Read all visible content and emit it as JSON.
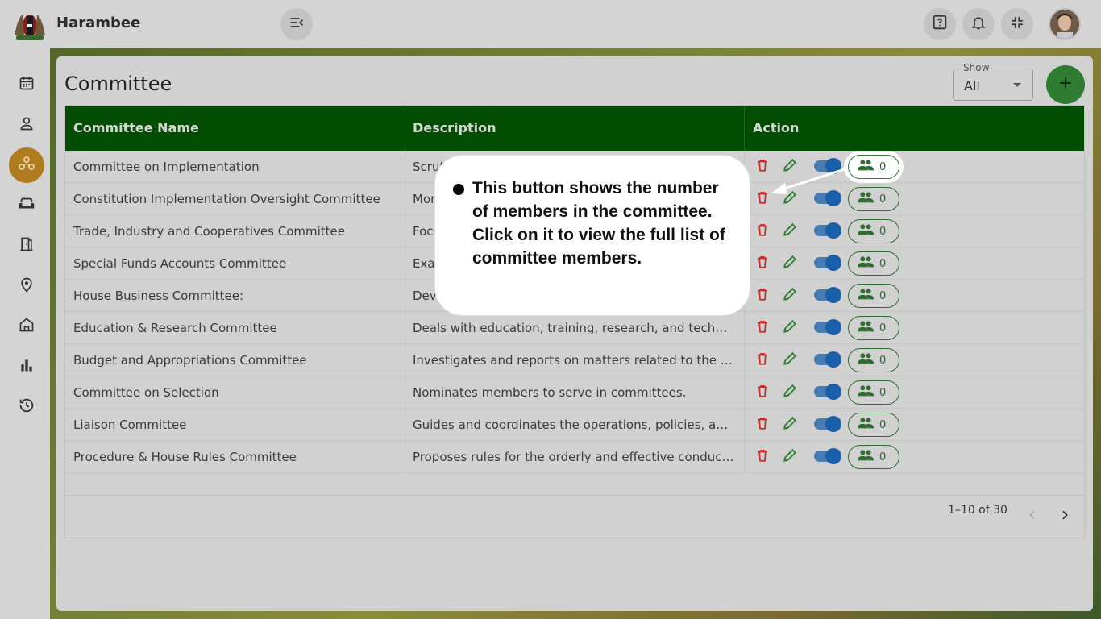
{
  "app": {
    "name": "Harambee"
  },
  "header": {
    "icons": [
      "menu-collapse-icon",
      "help-icon",
      "bell-icon",
      "fullscreen-exit-icon",
      "avatar"
    ]
  },
  "sidebar": {
    "items": [
      {
        "icon": "calendar-icon"
      },
      {
        "icon": "person-icon"
      },
      {
        "icon": "committee-icon",
        "active": true
      },
      {
        "icon": "sofa-icon"
      },
      {
        "icon": "door-icon"
      },
      {
        "icon": "location-pin-icon"
      },
      {
        "icon": "building-icon"
      },
      {
        "icon": "bar-chart-icon"
      },
      {
        "icon": "history-icon"
      }
    ]
  },
  "page": {
    "title": "Committee",
    "show_label": "Show",
    "show_value": "All"
  },
  "table": {
    "headers": {
      "name": "Committee Name",
      "description": "Description",
      "action": "Action"
    },
    "rows": [
      {
        "name": "Committee on Implementation",
        "description": "Scrutinizes the resolutions of the House",
        "members": "0"
      },
      {
        "name": "Constitution Implementation Oversight Committee",
        "description": "Monitors the implementation of the Constitution",
        "members": "0"
      },
      {
        "name": "Trade, Industry and Cooperatives Committee",
        "description": "Focuses on trade, industry and cooperatives",
        "members": "0"
      },
      {
        "name": "Special Funds Accounts Committee",
        "description": "Examines the accounts of special funds",
        "members": "0"
      },
      {
        "name": "House Business Committee:",
        "description": "Develops the programme of the House",
        "members": "0"
      },
      {
        "name": "Education & Research Committee",
        "description": "Deals with education, training, research, and technolo...",
        "members": "0"
      },
      {
        "name": "Budget and Appropriations Committee",
        "description": "Investigates and reports on matters related to the nati...",
        "members": "0"
      },
      {
        "name": "Committee on Selection",
        "description": "Nominates members to serve in committees.",
        "members": "0"
      },
      {
        "name": "Liaison Committee",
        "description": "Guides and coordinates the operations, policies, and ...",
        "members": "0"
      },
      {
        "name": "Procedure & House Rules Committee",
        "description": "Proposes rules for the orderly and effective conduct of ...",
        "members": "0"
      }
    ],
    "pagination": "1–10 of 30"
  },
  "callout": {
    "text": "This button shows the number of members in the committee. Click on it to view the full list of committee members."
  },
  "colors": {
    "table_header": "#034d03",
    "delete": "#c62828",
    "edit": "#2e7d32",
    "toggle": "#1a5faa",
    "active_sidebar": "#b07c20"
  }
}
